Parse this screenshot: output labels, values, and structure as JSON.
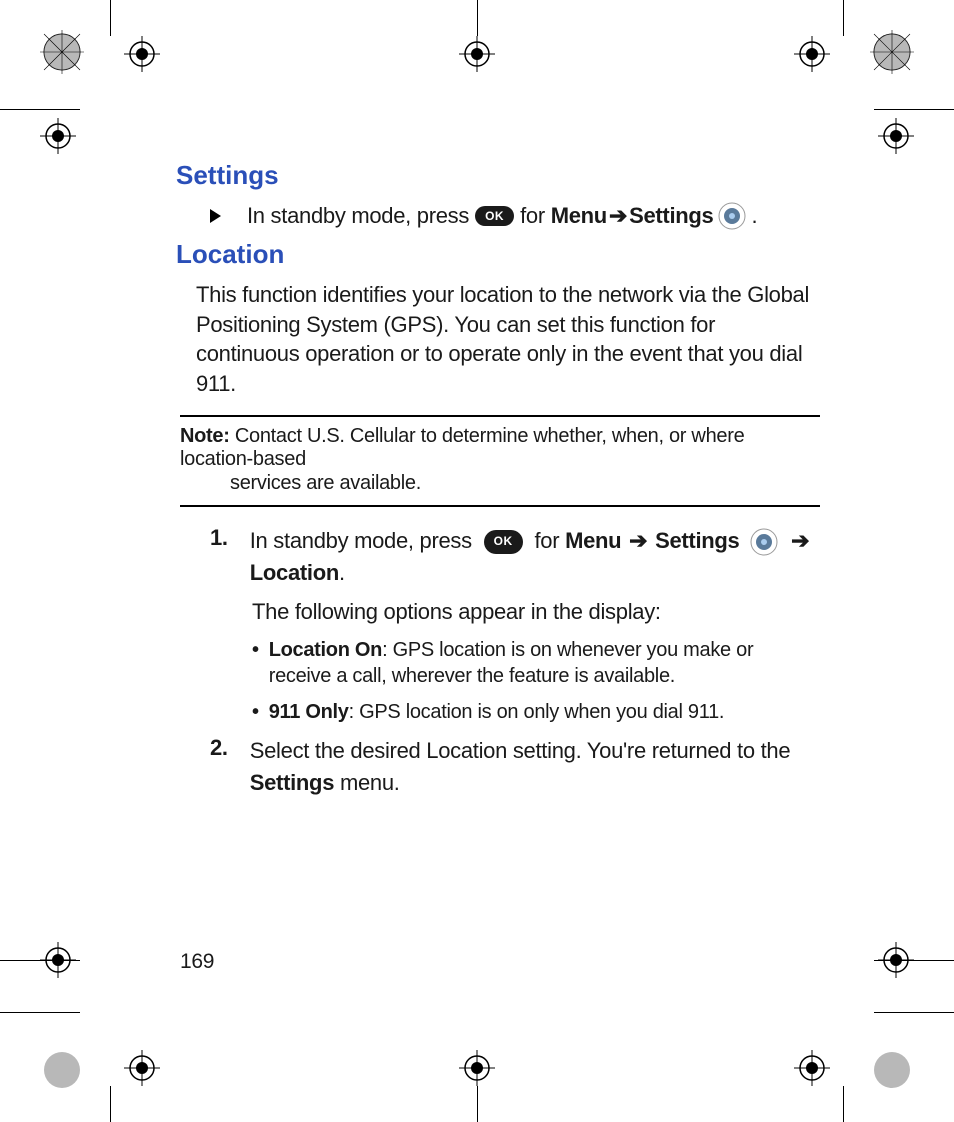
{
  "headings": {
    "settings": "Settings",
    "location": "Location"
  },
  "intro_step": {
    "pre": "In standby mode, press",
    "ok": "OK",
    "for": "for",
    "menu": "Menu",
    "arrow": "➔",
    "settings": "Settings",
    "period": "."
  },
  "location_para": "This function identifies your location to the network via the Global Positioning System (GPS). You can set this function for continuous operation or to operate only in the event that you dial 911.",
  "note": {
    "label": "Note:",
    "body_first": "Contact U.S. Cellular to determine whether, when, or where location-based",
    "body_rest": "services are available."
  },
  "steps": {
    "s1": {
      "num": "1.",
      "pre": "In standby mode, press",
      "ok": "OK",
      "for": "for",
      "menu": "Menu",
      "arrow": "➔",
      "settings": "Settings",
      "arrow2": "➔",
      "location": "Location",
      "period": "."
    },
    "sub": "The following options appear in the display:",
    "opt1": {
      "label": "Location On",
      "text": ": GPS location is on whenever you make or receive a call, wherever the feature is available."
    },
    "opt2": {
      "label": "911 Only",
      "text": ": GPS location is on only when you dial 911."
    },
    "s2": {
      "num": "2.",
      "pre": "Select the desired Location setting. You're returned to the ",
      "bold": "Settings",
      "post": " menu."
    }
  },
  "page_number": "169"
}
